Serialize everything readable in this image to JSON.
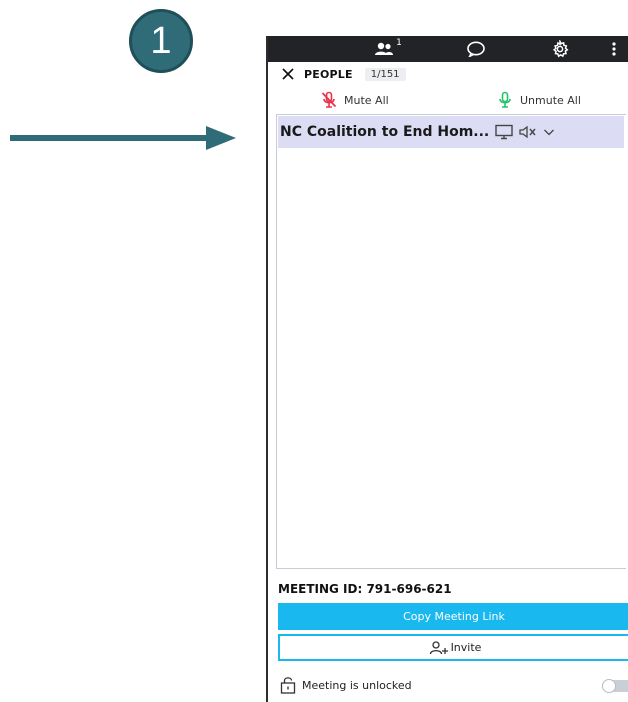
{
  "step_badge": {
    "number": "1"
  },
  "topbar": {
    "people_count": "1",
    "icons": [
      "people-icon",
      "chat-icon",
      "settings-icon",
      "more-vertical-icon"
    ]
  },
  "people": {
    "title": "PEOPLE",
    "count": "1/151"
  },
  "controls": {
    "mute_all": "Mute All",
    "unmute_all": "Unmute All"
  },
  "participants": [
    {
      "name": "NC Coalition to End Hom..."
    }
  ],
  "meeting": {
    "id_label": "MEETING ID: 791-696-621",
    "copy_link": "Copy Meeting Link",
    "invite": "Invite",
    "lock_status": "Meeting is unlocked"
  },
  "colors": {
    "accent": "#19b8ef",
    "badge": "#2f6c78",
    "topbar": "#222326",
    "selected_row": "#dcdcf5",
    "mute_red": "#e8334a",
    "unmute_green": "#22c36a"
  }
}
